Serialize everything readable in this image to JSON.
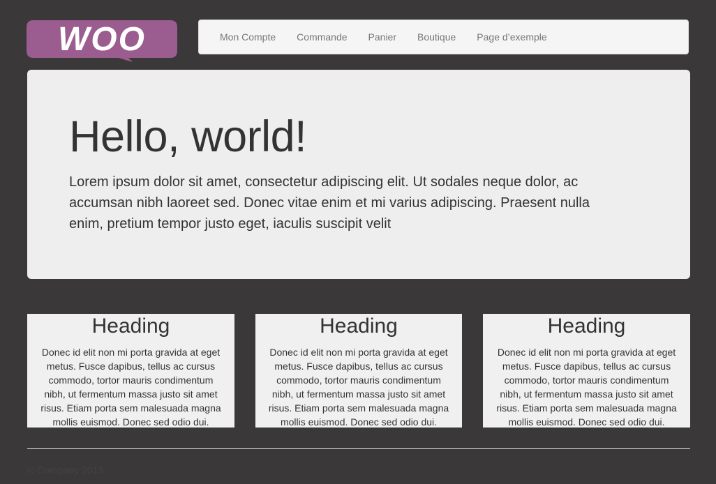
{
  "brand": {
    "logo_text": "WOO",
    "logo_color": "#9b5c8f"
  },
  "nav": {
    "items": [
      {
        "label": "Mon Compte"
      },
      {
        "label": "Commande"
      },
      {
        "label": "Panier"
      },
      {
        "label": "Boutique"
      },
      {
        "label": "Page d’exemple"
      }
    ]
  },
  "hero": {
    "title": "Hello, world!",
    "text": "Lorem ipsum dolor sit amet, consectetur adipiscing elit. Ut sodales neque dolor, ac accumsan nibh laoreet sed. Donec vitae enim et mi varius adipiscing. Praesent nulla enim, pretium tempor justo eget, iaculis suscipit velit"
  },
  "columns": [
    {
      "heading": "Heading",
      "text": "Donec id elit non mi porta gravida at eget metus. Fusce dapibus, tellus ac cursus commodo, tortor mauris condimentum nibh, ut fermentum massa justo sit amet risus. Etiam porta sem malesuada magna mollis euismod. Donec sed odio dui."
    },
    {
      "heading": "Heading",
      "text": "Donec id elit non mi porta gravida at eget metus. Fusce dapibus, tellus ac cursus commodo, tortor mauris condimentum nibh, ut fermentum massa justo sit amet risus. Etiam porta sem malesuada magna mollis euismod. Donec sed odio dui."
    },
    {
      "heading": "Heading",
      "text": "Donec id elit non mi porta gravida at eget metus. Fusce dapibus, tellus ac cursus commodo, tortor mauris condimentum nibh, ut fermentum massa justo sit amet risus. Etiam porta sem malesuada magna mollis euismod. Donec sed odio dui."
    }
  ],
  "footer": {
    "text": "© Company 2013"
  },
  "colors": {
    "background": "#3a3839",
    "accent": "#9b5c8f"
  }
}
